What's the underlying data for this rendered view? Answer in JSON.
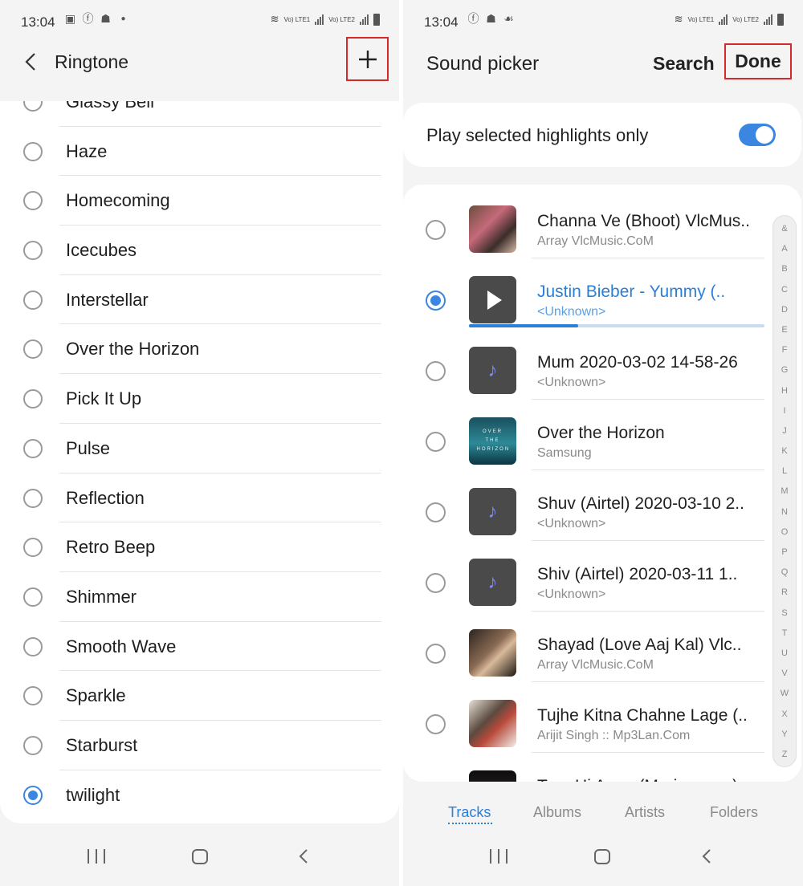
{
  "colors": {
    "accent": "#3a86e0",
    "highlight_box": "#d42a2a",
    "background": "#f4f4f4"
  },
  "left_screen": {
    "status": {
      "time": "13:04",
      "icons": [
        "image-icon",
        "facebook-icon",
        "app-icon",
        "dot-icon"
      ],
      "sim1": "Vo) LTE1",
      "sim2": "Vo) LTE2"
    },
    "header": {
      "back_icon": "back-arrow-icon",
      "title": "Ringtone",
      "add_icon": "plus-icon"
    },
    "ringtones": [
      {
        "label": "Glassy Bell",
        "selected": false
      },
      {
        "label": "Haze",
        "selected": false
      },
      {
        "label": "Homecoming",
        "selected": false
      },
      {
        "label": "Icecubes",
        "selected": false
      },
      {
        "label": "Interstellar",
        "selected": false
      },
      {
        "label": "Over the Horizon",
        "selected": false
      },
      {
        "label": "Pick It Up",
        "selected": false
      },
      {
        "label": "Pulse",
        "selected": false
      },
      {
        "label": "Reflection",
        "selected": false
      },
      {
        "label": "Retro Beep",
        "selected": false
      },
      {
        "label": "Shimmer",
        "selected": false
      },
      {
        "label": "Smooth Wave",
        "selected": false
      },
      {
        "label": "Sparkle",
        "selected": false
      },
      {
        "label": "Starburst",
        "selected": false
      },
      {
        "label": "twilight",
        "selected": true
      }
    ]
  },
  "right_screen": {
    "status": {
      "time": "13:04",
      "icons": [
        "facebook-icon",
        "app-icon",
        "app2-icon"
      ],
      "sim1": "Vo) LTE1",
      "sim2": "Vo) LTE2"
    },
    "header": {
      "title": "Sound picker",
      "search_label": "Search",
      "done_label": "Done"
    },
    "highlights": {
      "label": "Play selected highlights only",
      "enabled": true
    },
    "tracks": [
      {
        "title": "Channa Ve (Bhoot) VlcMus..",
        "subtitle": "Array VlcMusic.CoM",
        "art": "album-art",
        "selected": false
      },
      {
        "title": "Justin Bieber - Yummy (..",
        "subtitle": "<Unknown>",
        "art": "play-icon",
        "selected": true,
        "progress": 0.37
      },
      {
        "title": "Mum 2020-03-02 14-58-26",
        "subtitle": "<Unknown>",
        "art": "music-note-icon",
        "selected": false
      },
      {
        "title": "Over the Horizon",
        "subtitle": "Samsung",
        "art": "album-art",
        "art_text": "OVER THE HORIZON",
        "selected": false
      },
      {
        "title": "Shuv (Airtel) 2020-03-10 2..",
        "subtitle": "<Unknown>",
        "art": "music-note-icon",
        "selected": false
      },
      {
        "title": "Shiv (Airtel) 2020-03-11 1..",
        "subtitle": "<Unknown>",
        "art": "music-note-icon",
        "selected": false
      },
      {
        "title": "Shayad (Love Aaj Kal) Vlc..",
        "subtitle": "Array VlcMusic.CoM",
        "art": "album-art",
        "selected": false
      },
      {
        "title": "Tujhe Kitna Chahne Lage (..",
        "subtitle": "Arijit Singh :: Mp3Lan.Com",
        "art": "album-art",
        "selected": false
      },
      {
        "title": "Tum Hi Aana (Marjaavaan)",
        "subtitle": "",
        "art": "album-art",
        "selected": false
      }
    ],
    "alphabet": [
      "&",
      "A",
      "B",
      "C",
      "D",
      "E",
      "F",
      "G",
      "H",
      "I",
      "J",
      "K",
      "L",
      "M",
      "N",
      "O",
      "P",
      "Q",
      "R",
      "S",
      "T",
      "U",
      "V",
      "W",
      "X",
      "Y",
      "Z"
    ],
    "tabs": [
      {
        "label": "Tracks",
        "active": true
      },
      {
        "label": "Albums",
        "active": false
      },
      {
        "label": "Artists",
        "active": false
      },
      {
        "label": "Folders",
        "active": false
      }
    ]
  },
  "navbar": {
    "recent_icon": "recent-apps-icon",
    "home_icon": "home-icon",
    "back_icon": "back-icon"
  }
}
